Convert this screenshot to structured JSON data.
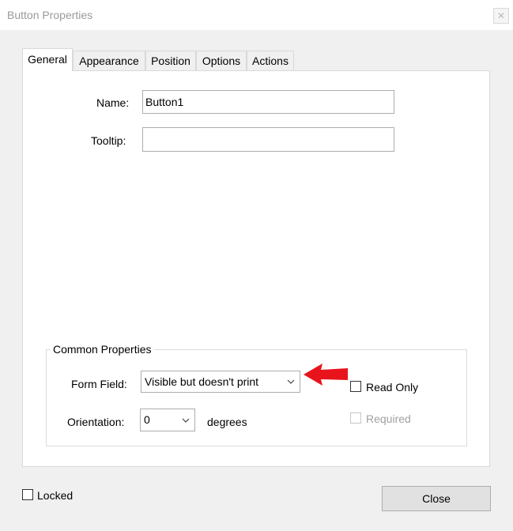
{
  "window": {
    "title": "Button Properties",
    "close_glyph": "✕"
  },
  "tabs": [
    {
      "label": "General",
      "active": true
    },
    {
      "label": "Appearance",
      "active": false
    },
    {
      "label": "Position",
      "active": false
    },
    {
      "label": "Options",
      "active": false
    },
    {
      "label": "Actions",
      "active": false
    }
  ],
  "general": {
    "name_label": "Name:",
    "name_value": "Button1",
    "tooltip_label": "Tooltip:",
    "tooltip_value": ""
  },
  "common_properties": {
    "title": "Common Properties",
    "form_field_label": "Form Field:",
    "form_field_value": "Visible but doesn't print",
    "orientation_label": "Orientation:",
    "orientation_value": "0",
    "orientation_unit": "degrees",
    "read_only_label": "Read Only",
    "read_only_checked": false,
    "required_label": "Required",
    "required_checked": false,
    "required_enabled": false
  },
  "footer": {
    "locked_label": "Locked",
    "locked_checked": false,
    "close_label": "Close"
  },
  "colors": {
    "annotation_arrow": "#e8141c"
  }
}
